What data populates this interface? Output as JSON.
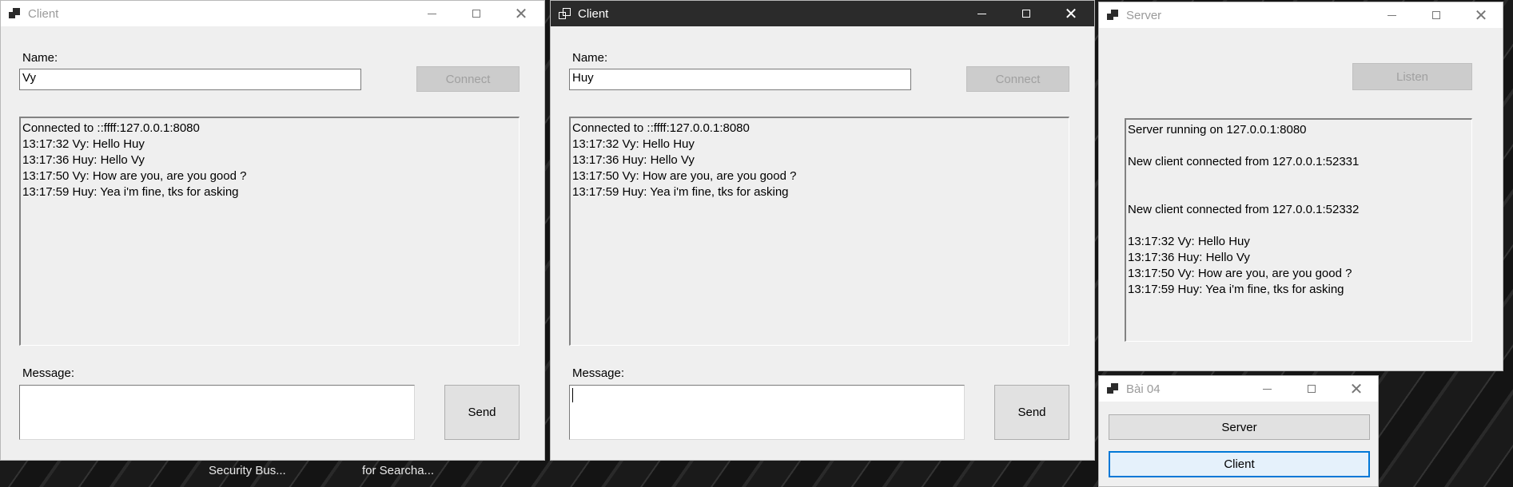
{
  "taskbar": {
    "items": [
      "Security Bus...",
      "for Searcha..."
    ]
  },
  "client1": {
    "title": "Client",
    "name_label": "Name:",
    "name_value": "Vy",
    "connect_label": "Connect",
    "log": [
      "Connected to ::ffff:127.0.0.1:8080",
      "13:17:32 Vy: Hello Huy",
      "13:17:36 Huy: Hello Vy",
      "13:17:50 Vy: How are you, are you good ?",
      "13:17:59 Huy: Yea i'm fine, tks for asking"
    ],
    "message_label": "Message:",
    "message_value": "",
    "send_label": "Send"
  },
  "client2": {
    "title": "Client",
    "name_label": "Name:",
    "name_value": "Huy",
    "connect_label": "Connect",
    "log": [
      "Connected to ::ffff:127.0.0.1:8080",
      "13:17:32 Vy: Hello Huy",
      "13:17:36 Huy: Hello Vy",
      "13:17:50 Vy: How are you, are you good ?",
      "13:17:59 Huy: Yea i'm fine, tks for asking"
    ],
    "message_label": "Message:",
    "message_value": "",
    "send_label": "Send"
  },
  "server": {
    "title": "Server",
    "listen_label": "Listen",
    "log": [
      "Server running on 127.0.0.1:8080",
      "",
      "New client connected from 127.0.0.1:52331",
      "",
      "",
      "New client connected from 127.0.0.1:52332",
      "",
      "13:17:32 Vy: Hello Huy",
      "13:17:36 Huy: Hello Vy",
      "13:17:50 Vy: How are you, are you good ?",
      "13:17:59 Huy: Yea i'm fine, tks for asking"
    ]
  },
  "launcher": {
    "title": "Bài 04",
    "server_label": "Server",
    "client_label": "Client"
  }
}
